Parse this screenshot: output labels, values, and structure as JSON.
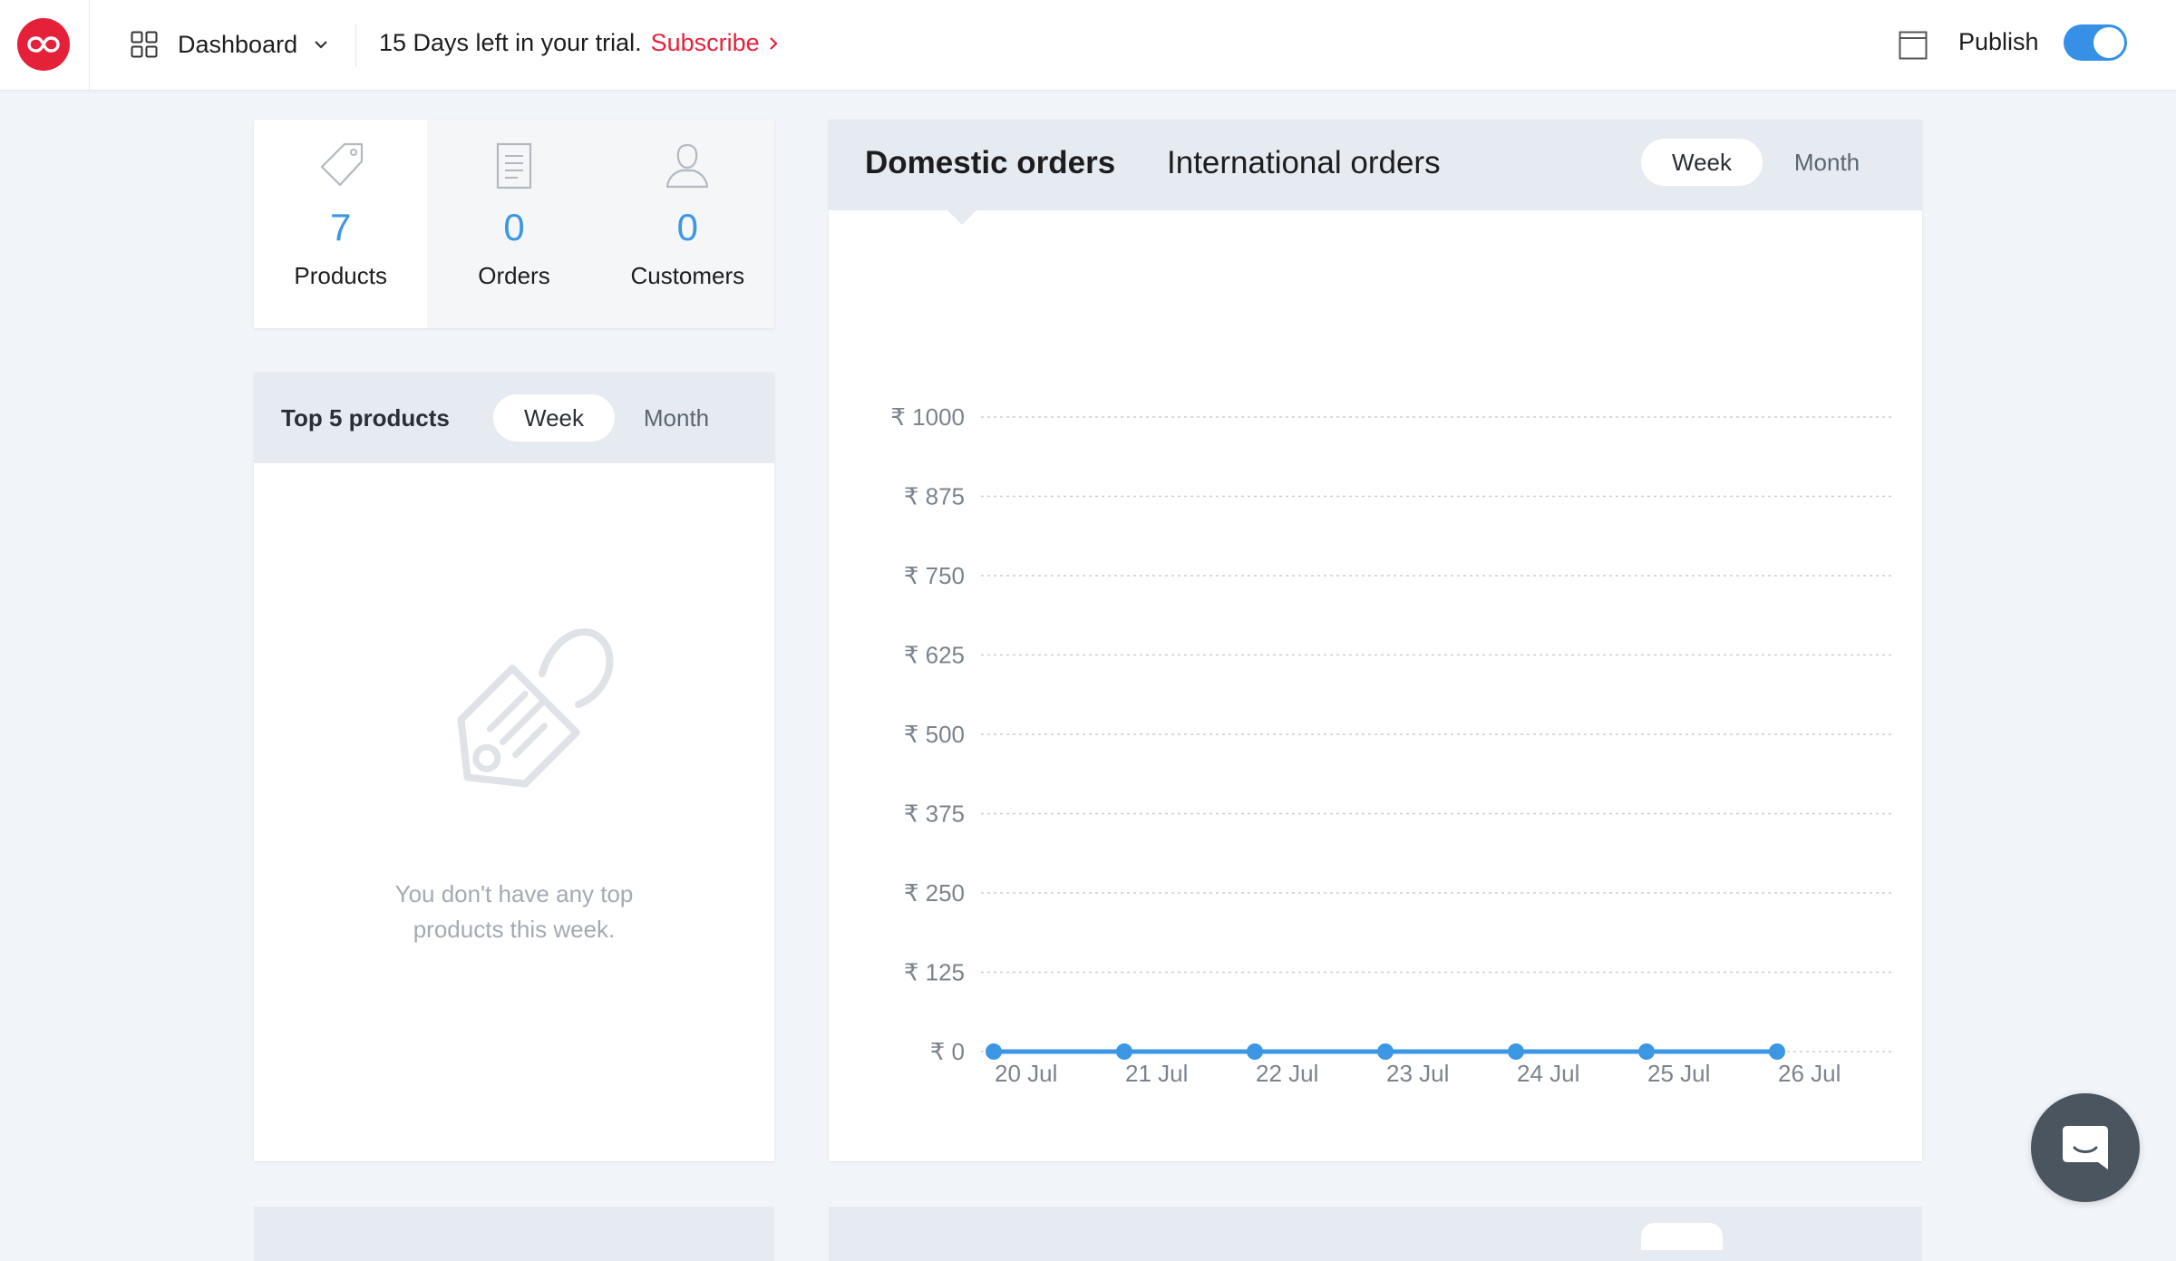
{
  "topbar": {
    "nav_label": "Dashboard",
    "trial_text": "15 Days left in your trial.",
    "subscribe_label": "Subscribe",
    "publish_label": "Publish",
    "publish_on": true,
    "accent": "#e5213a",
    "toggle_color": "#3590e6"
  },
  "stats": [
    {
      "icon": "tag-icon",
      "value": "7",
      "label": "Products"
    },
    {
      "icon": "document-icon",
      "value": "0",
      "label": "Orders"
    },
    {
      "icon": "user-icon",
      "value": "0",
      "label": "Customers"
    }
  ],
  "top_products": {
    "title": "Top 5 products",
    "range_week": "Week",
    "range_month": "Month",
    "active_range": "Week",
    "empty_line1": "You don't have any top",
    "empty_line2": "products this week."
  },
  "orders": {
    "tab_domestic": "Domestic orders",
    "tab_international": "International orders",
    "active_tab": "Domestic orders",
    "range_week": "Week",
    "range_month": "Month",
    "active_range": "Week"
  },
  "chart_data": {
    "type": "line",
    "x": [
      "20 Jul",
      "21 Jul",
      "22 Jul",
      "23 Jul",
      "24 Jul",
      "25 Jul",
      "26 Jul"
    ],
    "values": [
      0,
      0,
      0,
      0,
      0,
      0,
      0
    ],
    "yticks": [
      0,
      125,
      250,
      375,
      500,
      625,
      750,
      875,
      1000
    ],
    "ytick_labels": [
      "₹ 0",
      "₹ 125",
      "₹ 250",
      "₹ 375",
      "₹ 500",
      "₹ 625",
      "₹ 750",
      "₹ 875",
      "₹ 1000"
    ],
    "ylim": [
      0,
      1000
    ],
    "grid": true,
    "line_color": "#3b97e3"
  }
}
